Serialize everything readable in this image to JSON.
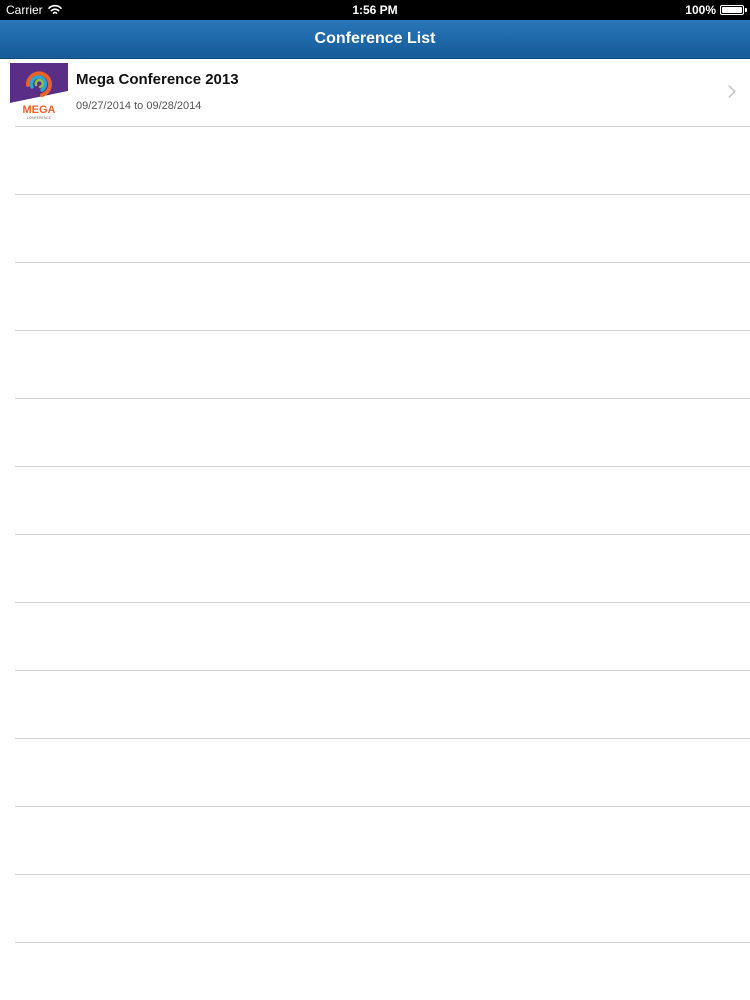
{
  "status_bar": {
    "carrier": "Carrier",
    "time": "1:56 PM",
    "battery": "100%",
    "battery_level": 1.0,
    "icons": [
      "wifi-icon",
      "battery-icon"
    ]
  },
  "nav_bar": {
    "title": "Conference List",
    "color": "#1f6aab"
  },
  "conferences": [
    {
      "title": "Mega Conference 2013",
      "dates": "09/27/2014 to 09/28/2014",
      "logo_text": "MEGA",
      "logo_subtext": "CONFERENCE",
      "icons": [
        "conference-logo-icon",
        "chevron-right-icon"
      ]
    }
  ],
  "empty_rows": 13,
  "colors": {
    "separator": "#cfcfd3",
    "chevron": "#c7c7cc",
    "logo_purple": "#5a2d86"
  }
}
